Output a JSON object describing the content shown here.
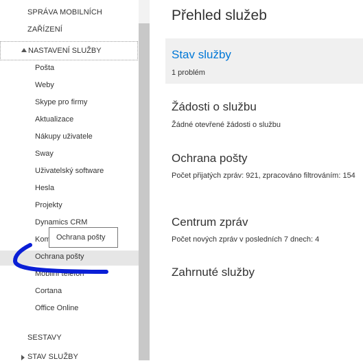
{
  "sidebar": {
    "sections": {
      "mobile_devices": "SPRÁVA MOBILNÍCH",
      "devices": "ZAŘÍZENÍ",
      "service_settings": "NASTAVENÍ SLUŽBY",
      "reports": "SESTAVY",
      "service_health": "STAV SLUŽBY"
    },
    "items": [
      {
        "label": "Pošta"
      },
      {
        "label": "Weby"
      },
      {
        "label": "Skype pro firmy"
      },
      {
        "label": "Aktualizace"
      },
      {
        "label": "Nákupy uživatele"
      },
      {
        "label": "Sway"
      },
      {
        "label": "Uživatelský software"
      },
      {
        "label": "Hesla"
      },
      {
        "label": "Projekty"
      },
      {
        "label": "Dynamics CRM"
      },
      {
        "label": "Kom"
      },
      {
        "label": "Ochrana pošty"
      },
      {
        "label": "Mobilní telefon"
      },
      {
        "label": "Cortana"
      },
      {
        "label": "Office Online"
      }
    ],
    "selected_item": "Ochrana pošty",
    "tooltip": "Ochrana pošty"
  },
  "main": {
    "title": "Přehled služeb",
    "tiles": [
      {
        "title": "Stav služby",
        "text": "1 problém"
      },
      {
        "title": "Žádosti o službu",
        "text": "Žádné otevřené žádosti o službu"
      },
      {
        "title": "Ochrana pošty",
        "text": "Počet přijatých zpráv: 921, zpracováno filtrováním: 154"
      },
      {
        "title": "Centrum zpráv",
        "text": "Počet nových zpráv v posledních 7 dnech: 4"
      },
      {
        "title": "Zahrnuté služby",
        "text": ""
      }
    ]
  },
  "colors": {
    "link": "#0078d7",
    "annotation": "#0a1fd6",
    "selected_bg": "#e6e6e6"
  },
  "icons": {
    "expanded": "triangle-up-icon",
    "collapsed": "triangle-right-icon"
  }
}
